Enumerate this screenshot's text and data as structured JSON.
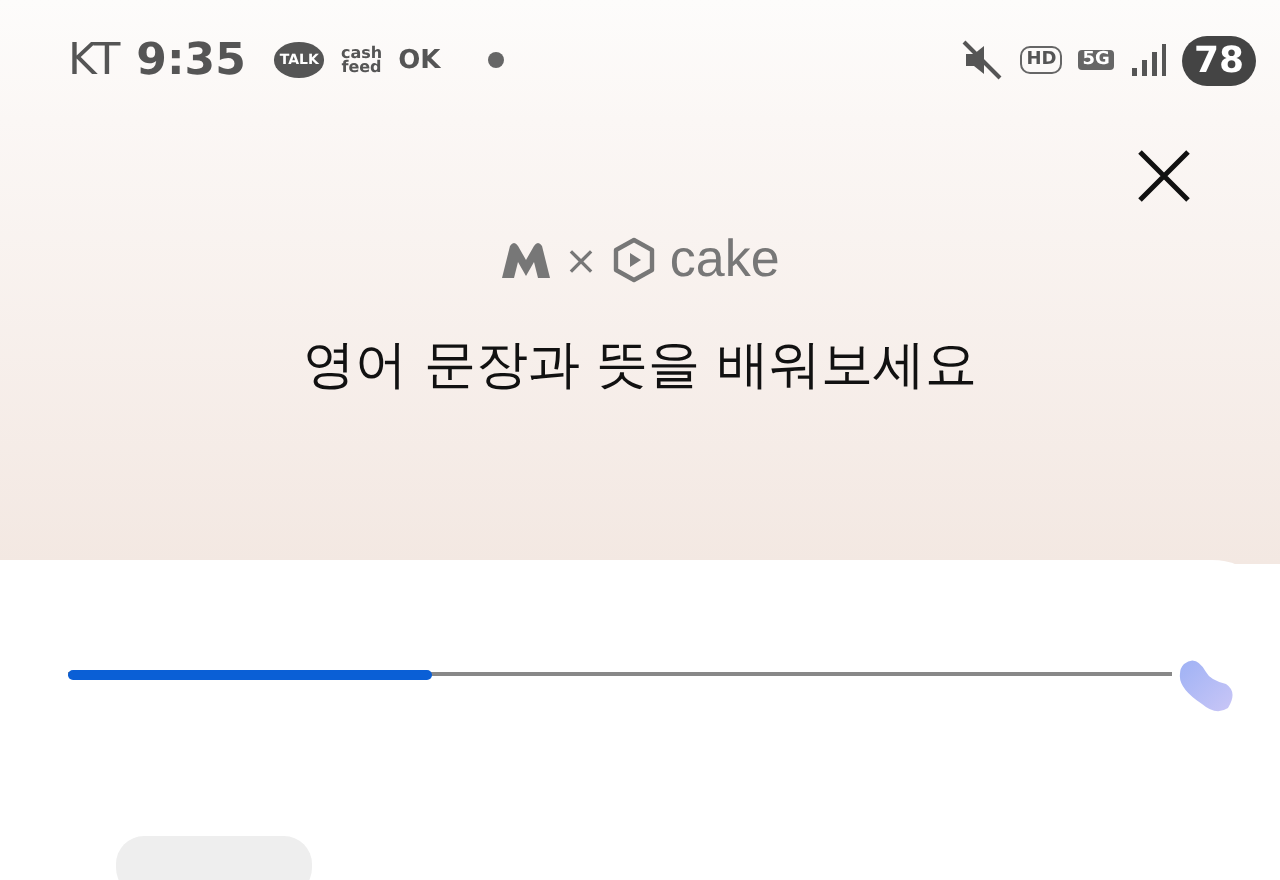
{
  "status_bar": {
    "carrier": "KT",
    "time": "9:35",
    "notifications": [
      "TALK",
      "cash\nfeed",
      "OK"
    ],
    "indicators": [
      "HD",
      "5G"
    ],
    "battery": "78"
  },
  "header": {
    "logo_cross": "×",
    "logo_brand": "cake",
    "title": "영어 문장과 뜻을 배워보세요"
  },
  "progress": {
    "level": 0.33
  }
}
